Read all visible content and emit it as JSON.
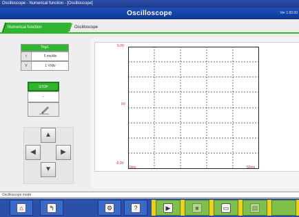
{
  "window": {
    "titlebar": "Oscilloscope - Numerical function - [Oscilloscope]",
    "title": "Oscilloscope",
    "version": "Ver 1.00.00"
  },
  "tabs": [
    {
      "label": "Numerical function"
    },
    {
      "label": "Oscilloscope"
    }
  ],
  "trig": {
    "header": "Trig/L",
    "rows": [
      {
        "key": "t",
        "value": "5 ms/div"
      },
      {
        "key": "V",
        "value": "1 V/div"
      }
    ]
  },
  "stop": {
    "header": "STOP",
    "value": "-"
  },
  "scope": {
    "y_top": "5.0V",
    "y_mid": "0V",
    "y_bottom": "-5.0V",
    "t_start": "0ms",
    "t_end": "50ms"
  },
  "status_text": "Oscilloscope mode",
  "icons": {
    "pen": "pen-icon",
    "up": "arrow-up-icon",
    "down": "arrow-down-icon",
    "left": "arrow-left-icon",
    "right": "arrow-right-icon"
  },
  "toolbar": [
    {
      "id": "home",
      "glyph": "⌂"
    },
    {
      "id": "back",
      "glyph": "↰"
    },
    {
      "id": "settings",
      "glyph": "⚙"
    },
    {
      "id": "question",
      "glyph": "?"
    },
    {
      "id": "play",
      "glyph": "▶"
    },
    {
      "id": "record",
      "glyph": "■"
    },
    {
      "id": "monitor",
      "glyph": "▭"
    },
    {
      "id": "chart",
      "glyph": "▤"
    }
  ],
  "colors": {
    "accent_green": "#2fb52f",
    "title_blue": "#1f4fb8",
    "label_red": "#cc2a2a",
    "toolbar_yellow": "#f0d010"
  }
}
